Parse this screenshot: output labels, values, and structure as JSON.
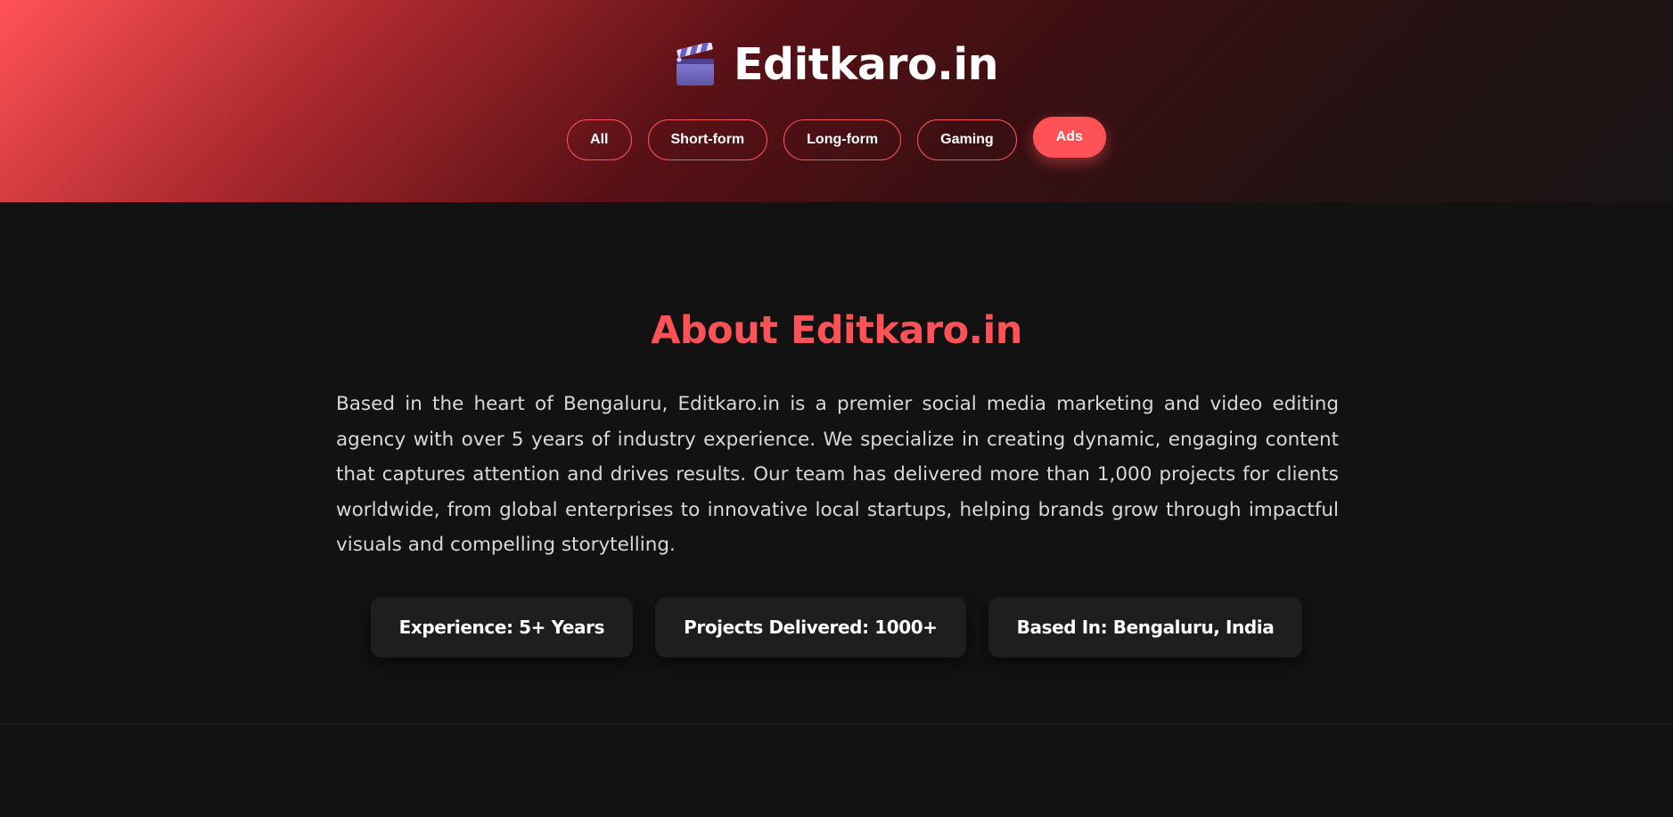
{
  "header": {
    "logo_icon": "clapperboard-icon",
    "title": "Editkaro.in",
    "filters": [
      {
        "label": "All",
        "active": false
      },
      {
        "label": "Short-form",
        "active": false
      },
      {
        "label": "Long-form",
        "active": false
      },
      {
        "label": "Gaming",
        "active": false
      },
      {
        "label": "Ads",
        "active": true
      }
    ]
  },
  "about": {
    "title": "About Editkaro.in",
    "paragraph": "Based in the heart of Bengaluru, Editkaro.in is a premier social media marketing and video editing agency with over 5 years of industry experience. We specialize in creating dynamic, engaging content that captures attention and drives results. Our team has delivered more than 1,000 projects for clients worldwide, from global enterprises to innovative local startups, helping brands grow through impactful visuals and compelling storytelling.",
    "stats": [
      "Experience: 5+ Years",
      "Projects Delivered: 1000+",
      "Based In: Bengaluru, India"
    ]
  },
  "colors": {
    "accent": "#ff5257",
    "background": "#121212",
    "card": "#1e1e1e"
  }
}
